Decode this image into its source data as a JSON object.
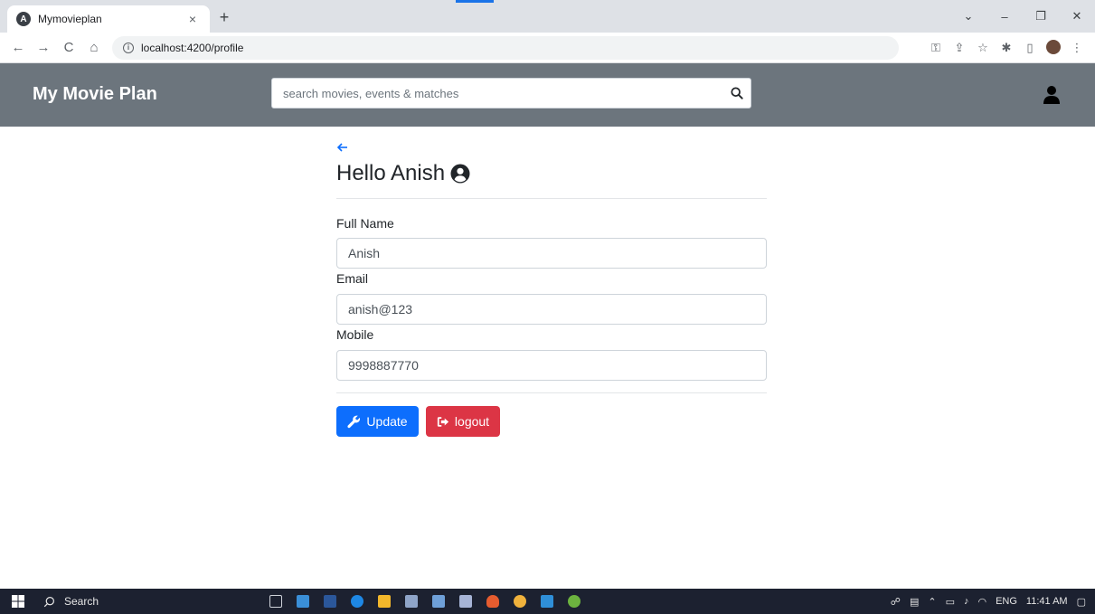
{
  "browser": {
    "tab_title": "Mymovieplan",
    "tab_close": "×",
    "new_tab": "+",
    "url": "localhost:4200/profile",
    "nav_back": "←",
    "nav_forward": "→",
    "nav_reload": "C",
    "nav_home": "⌂",
    "win_minimize": "–",
    "win_restore": "❐",
    "win_close": "✕",
    "tab_search": "⌄"
  },
  "navbar": {
    "brand": "My Movie Plan",
    "search_placeholder": "search movies, events & matches",
    "bg_color": "#6c757d"
  },
  "profile": {
    "greeting": "Hello Anish",
    "fields": [
      {
        "label": "Full Name",
        "value": "Anish"
      },
      {
        "label": "Email",
        "value": "anish@123"
      },
      {
        "label": "Mobile",
        "value": "9998887770"
      }
    ],
    "update_label": "Update",
    "logout_label": "logout",
    "update_color": "#0d6efd",
    "logout_color": "#dc3545"
  },
  "taskbar": {
    "search_label": "Search",
    "language": "ENG",
    "time": "11:41 AM"
  },
  "icons": {
    "back": "arrow-left-icon",
    "greeting": "user-circle-icon",
    "search": "magnifier-icon",
    "user": "user-icon",
    "update": "wrench-icon",
    "logout": "sign-out-icon"
  }
}
